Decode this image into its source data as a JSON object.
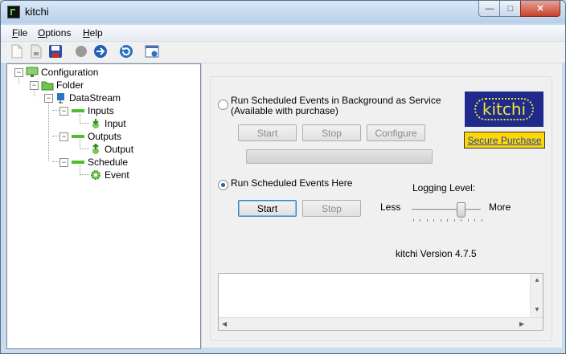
{
  "window": {
    "title": "kitchi"
  },
  "menu": [
    {
      "label": "File",
      "underline": "F",
      "rest": "ile"
    },
    {
      "label": "Options",
      "underline": "O",
      "rest": "ptions"
    },
    {
      "label": "Help",
      "underline": "H",
      "rest": "elp"
    }
  ],
  "toolbar": {
    "icons": [
      "new-file-icon",
      "open-file-icon",
      "save-icon",
      "record-icon",
      "forward-icon",
      "refresh-icon",
      "info-window-icon"
    ]
  },
  "tree": {
    "configuration": "Configuration",
    "folder": "Folder",
    "datastream": "DataStream",
    "inputs": "Inputs",
    "input": "Input",
    "outputs": "Outputs",
    "output": "Output",
    "schedule": "Schedule",
    "event": "Event"
  },
  "service": {
    "radio_line1": "Run Scheduled Events in Background as Service",
    "radio_line2": "(Available with purchase)",
    "start": "Start",
    "stop": "Stop",
    "configure": "Configure"
  },
  "logo": {
    "text": "kitchi"
  },
  "purchase": {
    "label": "Secure Purchase"
  },
  "local": {
    "radio_label": "Run Scheduled Events Here",
    "start": "Start",
    "stop": "Stop"
  },
  "logging": {
    "title": "Logging Level:",
    "less": "Less",
    "more": "More",
    "level": 0.7
  },
  "version": "kitchi Version 4.7.5"
}
